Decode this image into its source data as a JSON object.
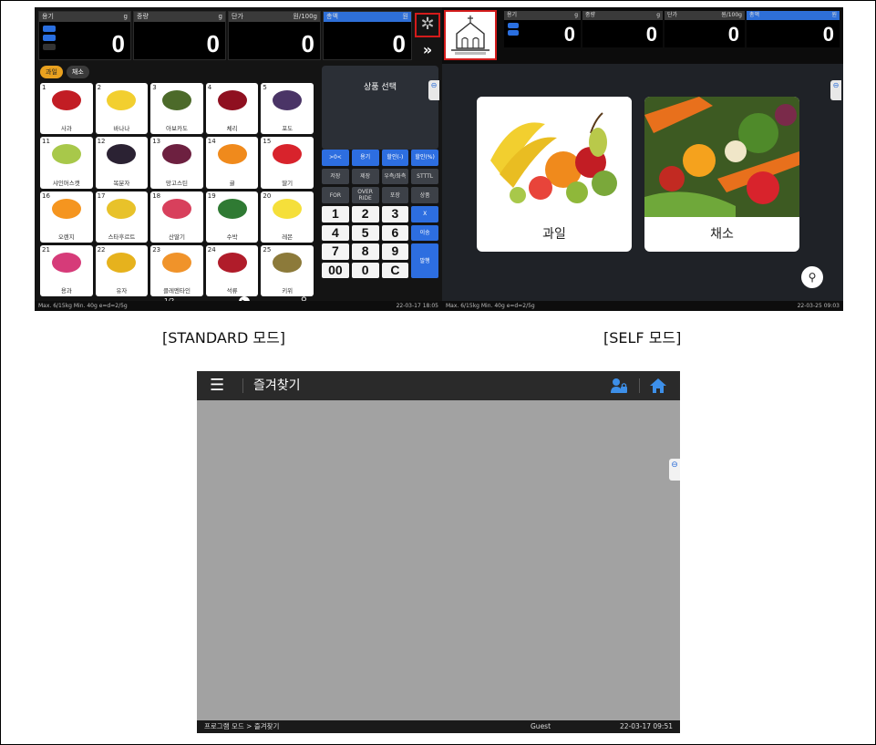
{
  "standard": {
    "caption": "[STANDARD 모드]",
    "displays": [
      {
        "label": "용기",
        "unit": "g",
        "value": "0"
      },
      {
        "label": "중량",
        "unit": "g",
        "value": "0"
      },
      {
        "label": "단가",
        "unit": "원/100g",
        "value": "0"
      },
      {
        "label": "총액",
        "unit": "원",
        "value": "0"
      }
    ],
    "categories": [
      "과일",
      "채소"
    ],
    "products": [
      {
        "no": "1",
        "name": "사과",
        "color": "#c21d24"
      },
      {
        "no": "2",
        "name": "바나나",
        "color": "#f2cf2f"
      },
      {
        "no": "3",
        "name": "아보카도",
        "color": "#4c6a2a"
      },
      {
        "no": "4",
        "name": "체리",
        "color": "#8f1020"
      },
      {
        "no": "5",
        "name": "포도",
        "color": "#4a3466"
      },
      {
        "no": "11",
        "name": "샤인머스캣",
        "color": "#a8c84a"
      },
      {
        "no": "12",
        "name": "복분자",
        "color": "#2b2233"
      },
      {
        "no": "13",
        "name": "망고스틴",
        "color": "#6d2040"
      },
      {
        "no": "14",
        "name": "귤",
        "color": "#f08a1c"
      },
      {
        "no": "15",
        "name": "딸기",
        "color": "#d8232c"
      },
      {
        "no": "16",
        "name": "오렌지",
        "color": "#f5951f"
      },
      {
        "no": "17",
        "name": "스타후르트",
        "color": "#e8c22a"
      },
      {
        "no": "18",
        "name": "산딸기",
        "color": "#d8405c"
      },
      {
        "no": "19",
        "name": "수박",
        "color": "#2f7a33"
      },
      {
        "no": "20",
        "name": "레몬",
        "color": "#f5df3a"
      },
      {
        "no": "21",
        "name": "용과",
        "color": "#d63b79"
      },
      {
        "no": "22",
        "name": "유자",
        "color": "#e6b21d"
      },
      {
        "no": "23",
        "name": "클레멘타인",
        "color": "#f0932a"
      },
      {
        "no": "24",
        "name": "석류",
        "color": "#b01c2a"
      },
      {
        "no": "25",
        "name": "키위",
        "color": "#8c7a3a"
      }
    ],
    "page": "1/2",
    "product_select": "상품 선택",
    "keypad": [
      ">0<",
      "용기",
      "할인(-)",
      "할인(%)",
      "저장",
      "제장",
      "우측/좌측",
      "STTTL",
      "FOR",
      "OVER RIDE",
      "포장",
      "상품",
      "1",
      "2",
      "3",
      "X",
      "4",
      "5",
      "6",
      "이송",
      "7",
      "8",
      "9",
      "발행",
      "00",
      "0",
      "C",
      ""
    ],
    "status_left": "Max. 6/15kg  Min. 40g  e=d=2/5g",
    "status_right": "22-03-17 18:05"
  },
  "self": {
    "caption": "[SELF 모드]",
    "displays": [
      {
        "label": "용기",
        "unit": "g",
        "value": "0"
      },
      {
        "label": "중량",
        "unit": "g",
        "value": "0"
      },
      {
        "label": "단가",
        "unit": "원/100g",
        "value": "0"
      },
      {
        "label": "총액",
        "unit": "원",
        "value": "0"
      }
    ],
    "cards": [
      "과일",
      "채소"
    ],
    "status_left": "Max. 6/15kg  Min. 40g  e=d=2/5g",
    "status_right": "22-03-25 09:03"
  },
  "favorites": {
    "title": "즐겨찾기",
    "footer_path": "프로그램 모드 > 즐겨찾기",
    "user": "Guest",
    "datetime": "22-03-17 09:51"
  }
}
